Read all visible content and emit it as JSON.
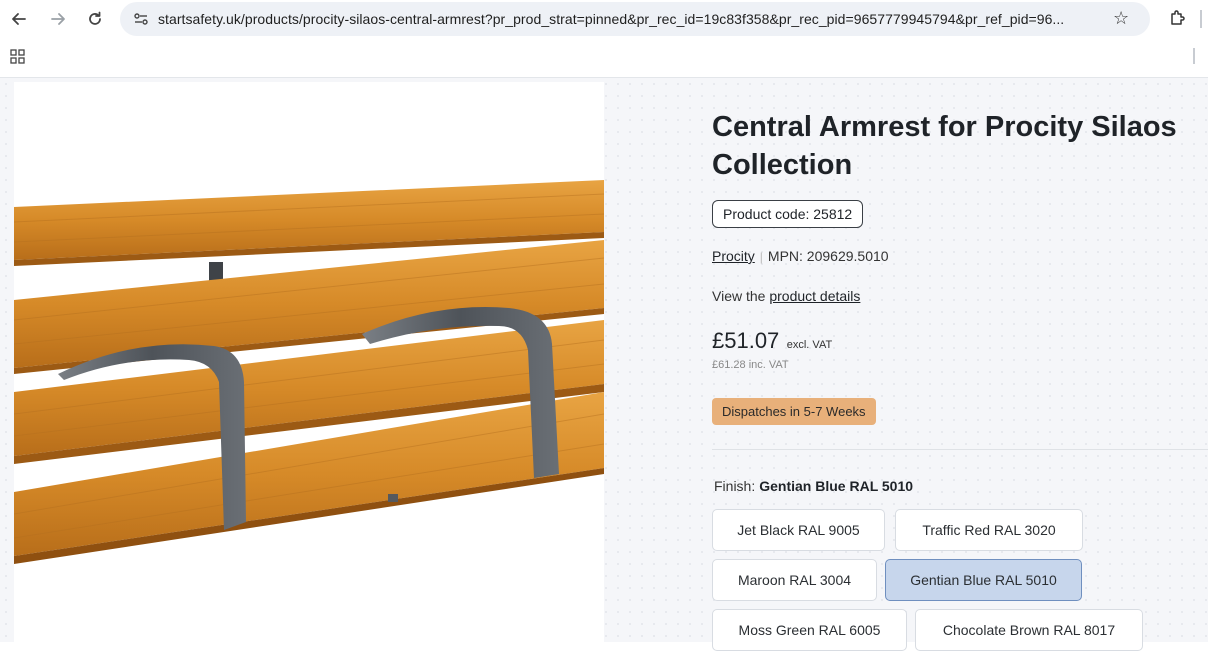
{
  "browser": {
    "url": "startsafety.uk/products/procity-silaos-central-armrest?pr_prod_strat=pinned&pr_rec_id=19c83f358&pr_rec_pid=9657779945794&pr_ref_pid=96...",
    "icons": [
      "back-arrow-icon",
      "forward-arrow-icon",
      "reload-icon",
      "site-settings-icon",
      "bookmark-star-icon",
      "extensions-icon",
      "apps-grid-icon"
    ]
  },
  "product": {
    "title": "Central Armrest for Procity Silaos Collection",
    "code_label": "Product code: 25812",
    "brand": "Procity",
    "mpn": "MPN: 209629.5010",
    "view_prefix": "View the ",
    "view_link": "product details",
    "price": "£51.07",
    "price_suffix": "excl. VAT",
    "price_inc": "£61.28",
    "price_inc_suffix": "inc. VAT",
    "dispatch": "Dispatches in 5-7 Weeks",
    "finish_label": "Finish:",
    "finish_selected": "Gentian Blue RAL 5010",
    "finishes": [
      "Jet Black RAL 9005",
      "Traffic Red RAL 3020",
      "Maroon RAL 3004",
      "Gentian Blue RAL 5010",
      "Moss Green RAL 6005",
      "Chocolate Brown RAL 8017"
    ]
  },
  "colors": {
    "dispatch_badge": "#e8b07a",
    "selected_option": "#c7d6ec",
    "wood": "#d9922e",
    "metal": "#5b6066"
  }
}
